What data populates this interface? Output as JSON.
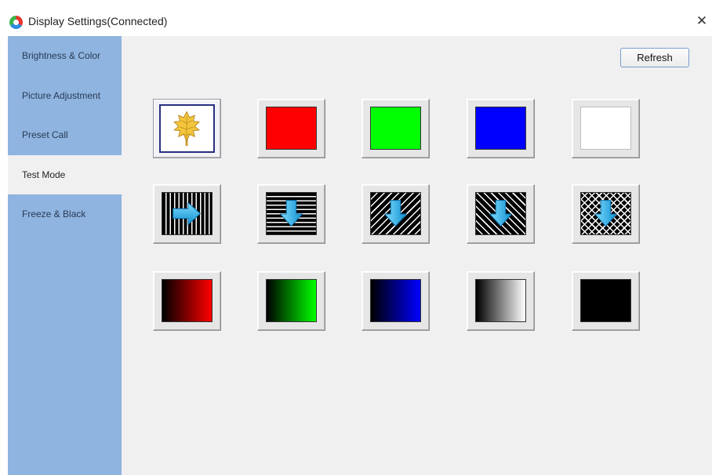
{
  "window": {
    "title": "Display Settings(Connected)",
    "close_glyph": "✕"
  },
  "sidebar": {
    "items": [
      {
        "label": "Brightness & Color",
        "active": false
      },
      {
        "label": "Picture Adjustment",
        "active": false
      },
      {
        "label": "Preset Call",
        "active": false
      },
      {
        "label": "Test Mode",
        "active": true
      },
      {
        "label": "Freeze & Black",
        "active": false
      }
    ]
  },
  "toolbar": {
    "refresh_label": "Refresh"
  },
  "test_patterns": [
    {
      "name": "leaf-logo",
      "icon": "leaf-icon",
      "selected": true
    },
    {
      "name": "solid-red",
      "color": "#ff0000"
    },
    {
      "name": "solid-green",
      "color": "#00ff00"
    },
    {
      "name": "solid-blue",
      "color": "#0000ff"
    },
    {
      "name": "solid-white",
      "color": "#ffffff"
    },
    {
      "name": "vertical-lines-scroll",
      "icon": "arrow-right-icon"
    },
    {
      "name": "horizontal-lines-scroll",
      "icon": "arrow-down-icon"
    },
    {
      "name": "diagonal-lines-left-scroll",
      "icon": "arrow-down-icon"
    },
    {
      "name": "diagonal-lines-right-scroll",
      "icon": "arrow-down-icon"
    },
    {
      "name": "crosshatch-scroll",
      "icon": "arrow-down-icon"
    },
    {
      "name": "red-gradient",
      "color": "#ff0000"
    },
    {
      "name": "green-gradient",
      "color": "#00ff00"
    },
    {
      "name": "blue-gradient",
      "color": "#0000ff"
    },
    {
      "name": "gray-gradient",
      "color": "#ffffff"
    },
    {
      "name": "solid-black",
      "color": "#000000"
    }
  ],
  "colors": {
    "sidebar_bg": "#8eb4df",
    "content_bg": "#f0f0f0",
    "arrow_cyan": "#29b6f6"
  }
}
